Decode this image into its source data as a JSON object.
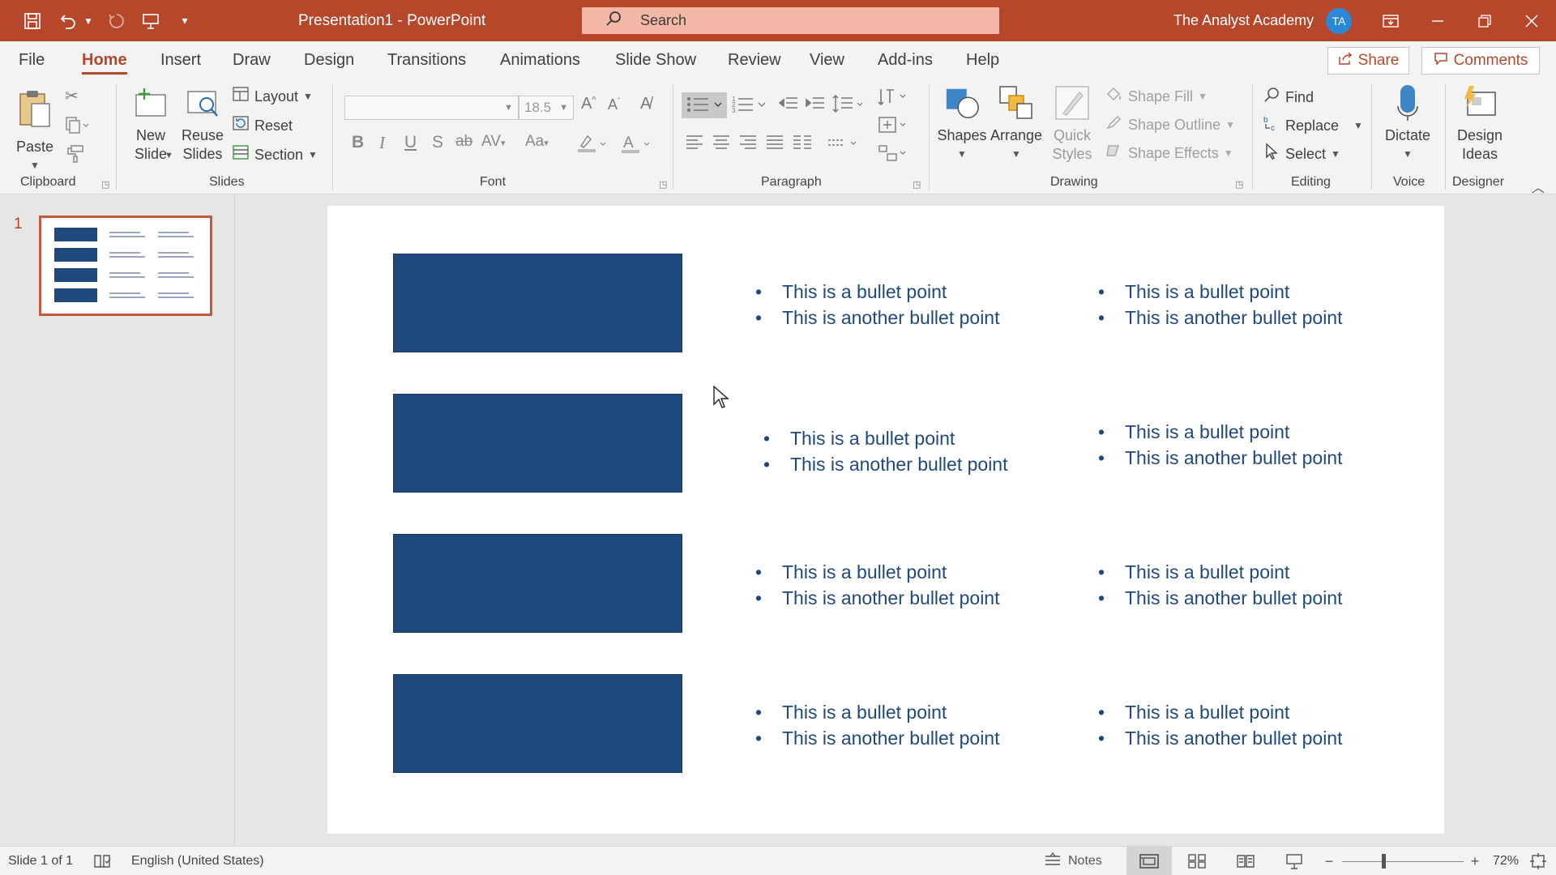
{
  "titlebar": {
    "doc_name": "Presentation1  -  PowerPoint",
    "search_label": "Search",
    "account_name": "The Analyst Academy",
    "avatar_initials": "TA"
  },
  "tabs": [
    "File",
    "Home",
    "Insert",
    "Draw",
    "Design",
    "Transitions",
    "Animations",
    "Slide Show",
    "Review",
    "View",
    "Add-ins",
    "Help"
  ],
  "active_tab": "Home",
  "share_label": "Share",
  "comments_label": "Comments",
  "ribbon": {
    "clipboard": {
      "paste": "Paste",
      "group": "Clipboard"
    },
    "slides": {
      "new_slide_1": "New",
      "new_slide_2": "Slide",
      "reuse_1": "Reuse",
      "reuse_2": "Slides",
      "layout": "Layout",
      "reset": "Reset",
      "section": "Section",
      "group": "Slides"
    },
    "font": {
      "font_size": "18.5",
      "group": "Font"
    },
    "paragraph": {
      "group": "Paragraph"
    },
    "drawing": {
      "shapes": "Shapes",
      "arrange": "Arrange",
      "quick_styles_1": "Quick",
      "quick_styles_2": "Styles",
      "shape_fill": "Shape Fill",
      "shape_outline": "Shape Outline",
      "shape_effects": "Shape Effects",
      "group": "Drawing"
    },
    "editing": {
      "find": "Find",
      "replace": "Replace",
      "select": "Select",
      "group": "Editing"
    },
    "voice": {
      "dictate": "Dictate",
      "group": "Voice"
    },
    "designer": {
      "design_ideas_1": "Design",
      "design_ideas_2": "Ideas",
      "group": "Designer"
    }
  },
  "thumbnail": {
    "number": "1"
  },
  "slide": {
    "rows": [
      {
        "left": [
          "This is a bullet point",
          "This is another bullet point"
        ],
        "right": [
          "This is a bullet point",
          "This is another bullet point"
        ]
      },
      {
        "left": [
          "This is a bullet point",
          "This is another bullet point"
        ],
        "right": [
          "This is a bullet point",
          "This is another bullet point"
        ]
      },
      {
        "left": [
          "This is a bullet point",
          "This is another bullet point"
        ],
        "right": [
          "This is a bullet point",
          "This is another bullet point"
        ]
      },
      {
        "left": [
          "This is a bullet point",
          "This is another bullet point"
        ],
        "right": [
          "This is a bullet point",
          "This is another bullet point"
        ]
      }
    ],
    "box_color": "#1f497d",
    "text_color": "#1f497d"
  },
  "status": {
    "slide_count": "Slide 1 of 1",
    "language": "English (United States)",
    "notes": "Notes",
    "zoom": "72%"
  },
  "colors": {
    "accent": "#b7472a"
  }
}
